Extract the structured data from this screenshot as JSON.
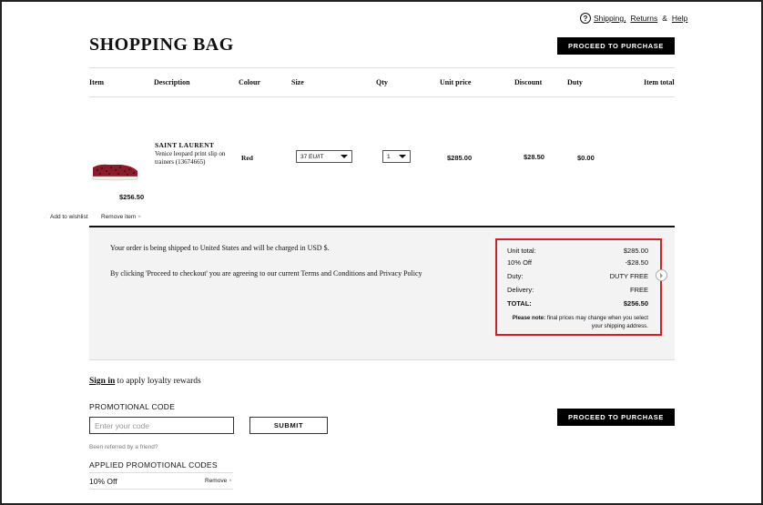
{
  "help": {
    "shipping": "Shipping,",
    "returns": "Returns",
    "amp": "&",
    "help": "Help"
  },
  "page_title": "SHOPPING BAG",
  "proceed_label": "PROCEED TO PURCHASE",
  "table_headers": {
    "item": "Item",
    "description": "Description",
    "colour": "Colour",
    "size": "Size",
    "qty": "Qty",
    "unit_price": "Unit price",
    "discount": "Discount",
    "duty": "Duty",
    "item_total": "Item total"
  },
  "product": {
    "brand": "SAINT LAURENT",
    "description": "Venice leopard print slip on trainers (13674665)",
    "colour": "Red",
    "size": "37 EU/IT",
    "qty": "1",
    "unit_price": "$285.00",
    "discount": "$28.50",
    "duty": "$0.00",
    "item_total": "$256.50",
    "add_to_wishlist": "Add to wishlist",
    "remove_item": "Remove item"
  },
  "shipping_notice": "Your order is being shipped to United States and will be charged in USD $.",
  "terms_notice": "By clicking 'Proceed to checkout' you are agreeing to our current Terms and Conditions and Privacy Policy",
  "summary": {
    "unit_total_label": "Unit total:",
    "unit_total": "$285.00",
    "discount_label": "10% Off",
    "discount": "-$28.50",
    "duty_label": "Duty:",
    "duty": "DUTY FREE",
    "delivery_label": "Delivery:",
    "delivery": "FREE",
    "total_label": "TOTAL:",
    "total": "$256.50",
    "note_label": "Please note:",
    "note_text": "final prices may change when you select your shipping address."
  },
  "loyalty": {
    "sign_in": "Sign in",
    "rest": "to apply loyalty rewards"
  },
  "promo": {
    "label": "PROMOTIONAL CODE",
    "placeholder": "Enter your code",
    "submit": "SUBMIT",
    "referred": "Been referred by a friend?",
    "applied_label": "APPLIED PROMOTIONAL CODES",
    "applied_code": "10% Off",
    "remove": "Remove"
  },
  "colors": {
    "accent_box": "#d42020",
    "summary_bg": "#f3f3f3",
    "button": "#000000"
  }
}
